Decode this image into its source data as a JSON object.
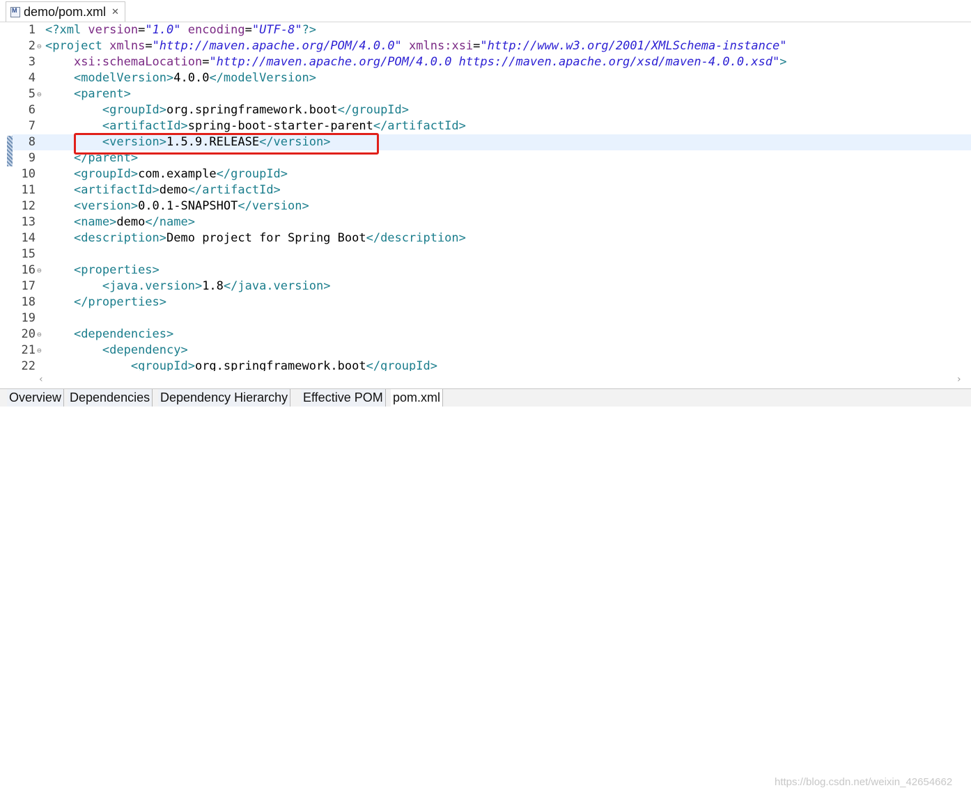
{
  "editor_tab": {
    "title": "demo/pom.xml",
    "close_glyph": "✕",
    "icon": "maven-file-icon"
  },
  "lines": [
    {
      "num": "1"
    },
    {
      "num": "2",
      "fold": "⊖"
    },
    {
      "num": "3"
    },
    {
      "num": "4"
    },
    {
      "num": "5",
      "fold": "⊖"
    },
    {
      "num": "6"
    },
    {
      "num": "7"
    },
    {
      "num": "8"
    },
    {
      "num": "9"
    },
    {
      "num": "10"
    },
    {
      "num": "11"
    },
    {
      "num": "12"
    },
    {
      "num": "13"
    },
    {
      "num": "14"
    },
    {
      "num": "15"
    },
    {
      "num": "16",
      "fold": "⊖"
    },
    {
      "num": "17"
    },
    {
      "num": "18"
    },
    {
      "num": "19"
    },
    {
      "num": "20",
      "fold": "⊖"
    },
    {
      "num": "21",
      "fold": "⊖"
    },
    {
      "num": "22"
    }
  ],
  "code": {
    "l1": {
      "open": "<?xml ",
      "a1": "version",
      "eq1": "=",
      "v1": "\"1.0\"",
      "sp": " ",
      "a2": "encoding",
      "eq2": "=",
      "v2": "\"UTF-8\"",
      "close": "?>"
    },
    "l2": {
      "open": "<project ",
      "a1": "xmlns",
      "eq1": "=",
      "v1": "\"http://maven.apache.org/POM/4.0.0\"",
      "sp": " ",
      "a2": "xmlns:xsi",
      "eq2": "=",
      "v2": "\"http://www.w3.org/2001/XMLSchema-instance\""
    },
    "l3": {
      "indent": "    ",
      "a1": "xsi:schemaLocation",
      "eq1": "=",
      "v1": "\"http://maven.apache.org/POM/4.0.0 https://maven.apache.org/xsd/maven-4.0.0.xsd\"",
      "close": ">"
    },
    "l4": {
      "indent": "    ",
      "otag": "<modelVersion>",
      "text": "4.0.0",
      "ctag": "</modelVersion>"
    },
    "l5": {
      "indent": "    ",
      "otag": "<parent>"
    },
    "l6": {
      "indent": "        ",
      "otag": "<groupId>",
      "text": "org.springframework.boot",
      "ctag": "</groupId>"
    },
    "l7": {
      "indent": "        ",
      "otag": "<artifactId>",
      "text": "spring-boot-starter-parent",
      "ctag": "</artifactId>"
    },
    "l8": {
      "indent": "        ",
      "otag": "<version>",
      "text": "1.5.9.RELEASE",
      "ctag": "</version>"
    },
    "l9": {
      "indent": "    ",
      "ctag": "</parent>"
    },
    "l10": {
      "indent": "    ",
      "otag": "<groupId>",
      "text": "com.example",
      "ctag": "</groupId>"
    },
    "l11": {
      "indent": "    ",
      "otag": "<artifactId>",
      "text": "demo",
      "ctag": "</artifactId>"
    },
    "l12": {
      "indent": "    ",
      "otag": "<version>",
      "text": "0.0.1-SNAPSHOT",
      "ctag": "</version>"
    },
    "l13": {
      "indent": "    ",
      "otag": "<name>",
      "text": "demo",
      "ctag": "</name>"
    },
    "l14": {
      "indent": "    ",
      "otag": "<description>",
      "text": "Demo project for Spring Boot",
      "ctag": "</description>"
    },
    "l16": {
      "indent": "    ",
      "otag": "<properties>"
    },
    "l17": {
      "indent": "        ",
      "otag": "<java.version>",
      "text": "1.8",
      "ctag": "</java.version>"
    },
    "l18": {
      "indent": "    ",
      "ctag": "</properties>"
    },
    "l20": {
      "indent": "    ",
      "otag": "<dependencies>"
    },
    "l21": {
      "indent": "        ",
      "otag": "<dependency>"
    },
    "l22": {
      "indent": "            ",
      "otag": "<groupId>",
      "text": "org.springframework.boot",
      "ctag": "</groupId>"
    }
  },
  "scrollbar": {
    "left_arrow": "‹",
    "right_arrow": "›"
  },
  "bottom_tabs": [
    {
      "label": "Overview"
    },
    {
      "label": "Dependencies"
    },
    {
      "label": "Dependency Hierarchy"
    },
    {
      "label": "Effective POM"
    },
    {
      "label": "pom.xml"
    }
  ],
  "watermark": "https://blog.csdn.net/weixin_42654662",
  "colors": {
    "tag": "#1a7d8c",
    "attribute": "#7b2a85",
    "value": "#2b1fd3",
    "highlight_box": "#e0201a",
    "current_line": "#e8f2fe"
  }
}
